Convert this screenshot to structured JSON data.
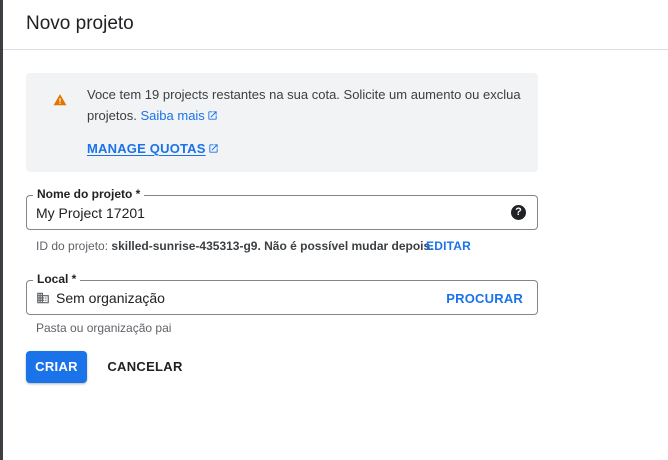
{
  "header": {
    "title": "Novo projeto"
  },
  "banner": {
    "message": "Voce tem 19 projects restantes na sua cota. Solicite um aumento ou exclua projetos.",
    "learn_more": "Saiba mais",
    "manage_quotas": "MANAGE QUOTAS",
    "icon": "warning-icon"
  },
  "project_name": {
    "label": "Nome do projeto *",
    "value": "My Project 17201",
    "help_icon": "help-icon"
  },
  "project_id": {
    "prefix": "ID do projeto:",
    "text": "skilled-sunrise-435313-g9. Não é possível mudar depois.",
    "edit": "EDITAR"
  },
  "location": {
    "label": "Local *",
    "value": "Sem organização",
    "browse": "PROCURAR",
    "hint": "Pasta ou organização pai",
    "icon": "building-icon"
  },
  "actions": {
    "create": "CRIAR",
    "cancel": "CANCELAR"
  },
  "colors": {
    "accent": "#1a73e8",
    "warning": "#e37400",
    "banner_bg": "#f1f3f4"
  }
}
